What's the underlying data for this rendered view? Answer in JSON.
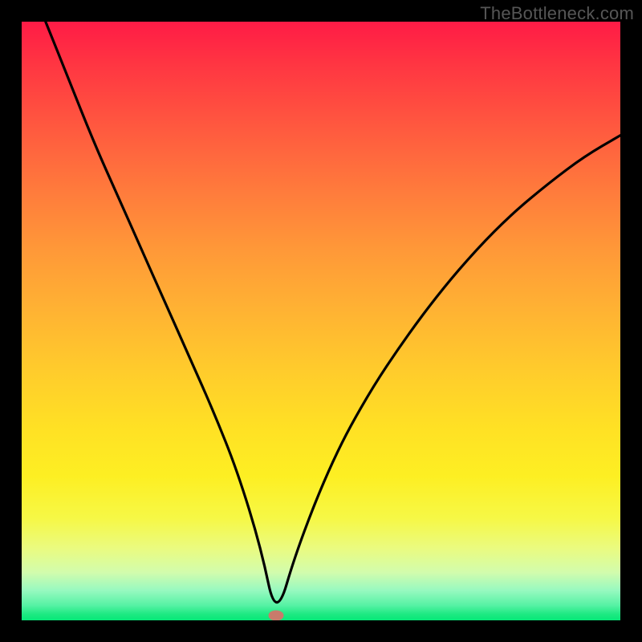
{
  "watermark": "TheBottleneck.com",
  "colors": {
    "background": "#000000",
    "curve": "#000000",
    "marker": "#c97b6b"
  },
  "marker": {
    "x_pct": 42.5,
    "y_pct": 99.2
  },
  "chart_data": {
    "type": "line",
    "title": "",
    "xlabel": "",
    "ylabel": "",
    "xlim": [
      0,
      100
    ],
    "ylim": [
      0,
      100
    ],
    "background_gradient": "red-to-green (vertical, red top, green bottom)",
    "series": [
      {
        "name": "bottleneck-curve",
        "x": [
          4,
          8,
          12,
          16,
          20,
          24,
          28,
          32,
          36,
          40,
          42.5,
          46,
          52,
          58,
          64,
          70,
          76,
          82,
          88,
          94,
          100
        ],
        "y": [
          100,
          90,
          80,
          71,
          62,
          53,
          44,
          35,
          25,
          12,
          0,
          12,
          27,
          38,
          47,
          55,
          62,
          68,
          73,
          77.5,
          81
        ]
      }
    ],
    "annotations": [
      {
        "type": "marker",
        "x": 42.5,
        "y": 0,
        "shape": "ellipse",
        "color": "#c97b6b"
      }
    ]
  }
}
